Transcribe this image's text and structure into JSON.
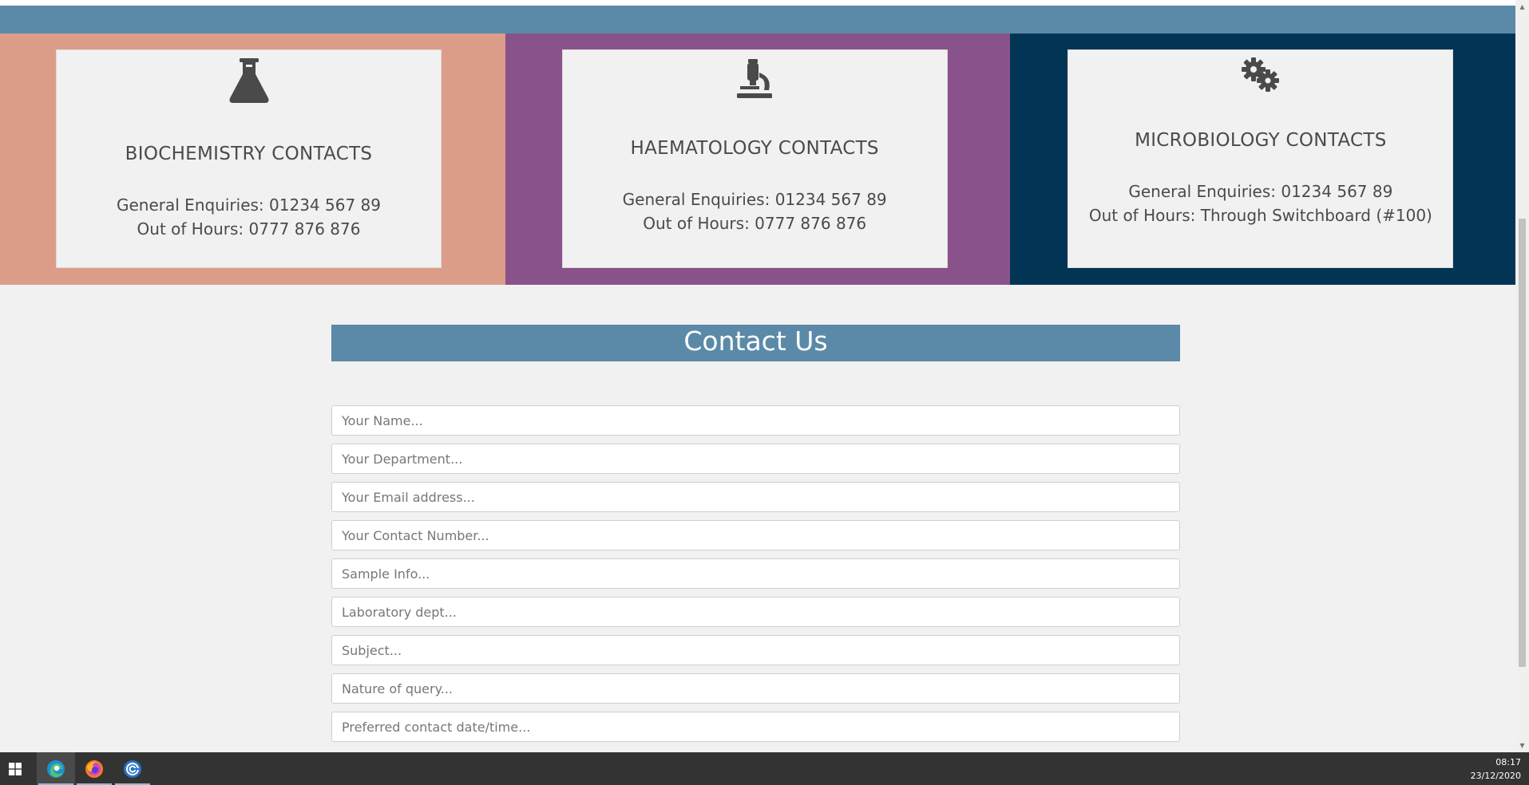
{
  "colors": {
    "banner": "#5b8aa8",
    "biochemistry_panel": "#dc9d88",
    "haematology_panel": "#8a528a",
    "microbiology_panel": "#023555",
    "icon": "#4a4a4a"
  },
  "contacts": [
    {
      "icon": "flask-icon",
      "title": "BIOCHEMISTRY CONTACTS",
      "general": "General Enquiries: 01234 567 89",
      "out_of_hours": "Out of Hours: 0777 876 876"
    },
    {
      "icon": "microscope-icon",
      "title": "HAEMATOLOGY CONTACTS",
      "general": "General Enquiries: 01234 567 89",
      "out_of_hours": "Out of Hours: 0777 876 876"
    },
    {
      "icon": "gears-icon",
      "title": "MICROBIOLOGY CONTACTS",
      "general": "General Enquiries: 01234 567 89",
      "out_of_hours": "Out of Hours: Through Switchboard (#100)"
    }
  ],
  "contact_form": {
    "heading": "Contact Us",
    "fields": {
      "name": "Your Name...",
      "department": "Your Department...",
      "email": "Your Email address...",
      "phone": "Your Contact Number...",
      "sample": "Sample Info...",
      "lab_dept": "Laboratory dept...",
      "subject": "Subject...",
      "nature": "Nature of query...",
      "preferred": "Preferred contact date/time..."
    }
  },
  "taskbar": {
    "apps": [
      "windows-start-icon",
      "edge-icon",
      "firefox-icon",
      "app-icon"
    ],
    "time": "08:17",
    "date": "23/12/2020"
  }
}
